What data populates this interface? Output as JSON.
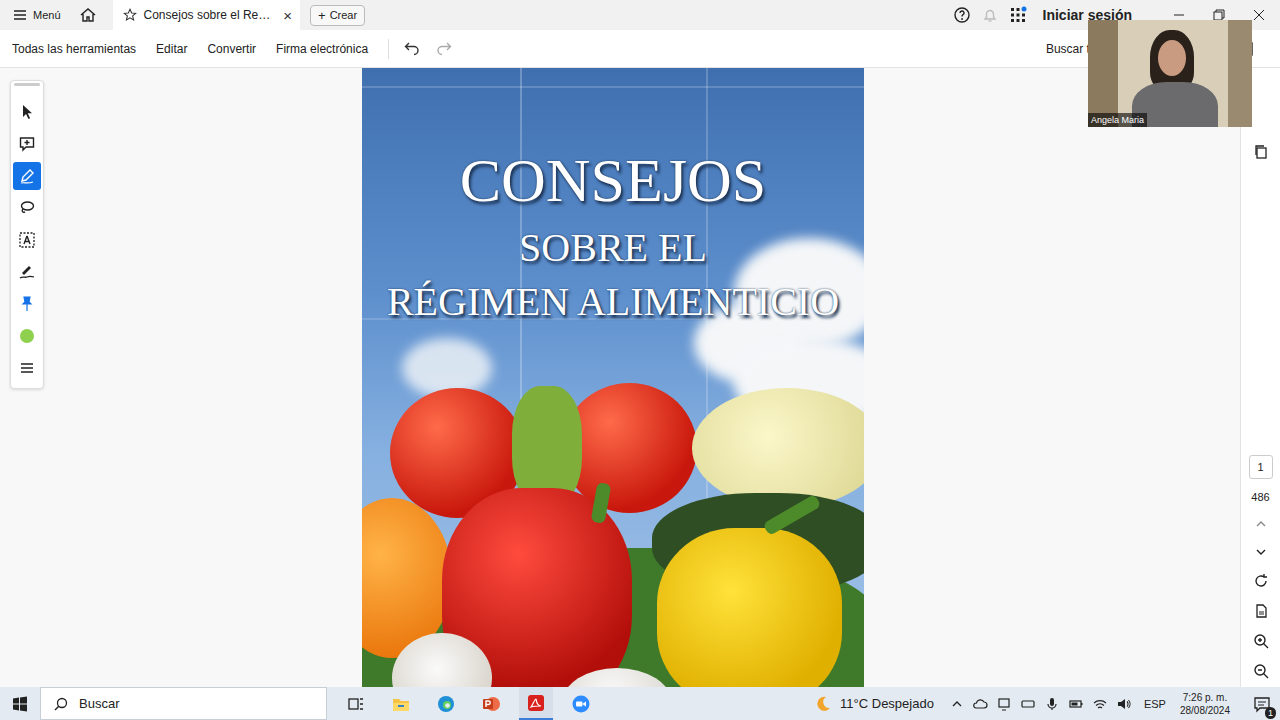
{
  "app_bar": {
    "menu": "Menú",
    "tab": {
      "label": "Consejos sobre el Re…",
      "selected": true,
      "close": "×"
    },
    "create_icon": "+",
    "create": "Crear",
    "sign_in": "Iniciar sesión"
  },
  "toolbar": {
    "items": [
      "Todas las herramientas",
      "Editar",
      "Convertir",
      "Firma electrónica"
    ],
    "search": "Buscar texto o herramientas"
  },
  "tools": [
    {
      "kind": "select",
      "selected": false
    },
    {
      "kind": "comment",
      "selected": false
    },
    {
      "kind": "pen",
      "selected": true
    },
    {
      "kind": "lasso",
      "selected": false
    },
    {
      "kind": "text-box",
      "selected": false
    },
    {
      "kind": "sign",
      "selected": false
    },
    {
      "kind": "pin",
      "selected": false
    },
    {
      "kind": "color",
      "selected": false,
      "color": "#8fd14f"
    },
    {
      "kind": "menu",
      "selected": false
    }
  ],
  "document": {
    "title_lines": [
      "CONSEJOS",
      "SOBRE EL",
      "RÉGIMEN ALIMENTICIO"
    ]
  },
  "page_nav": {
    "current": "1",
    "total": "486"
  },
  "video": {
    "name": "Angela Maria"
  },
  "taskbar": {
    "search": "Buscar",
    "apps": [
      {
        "kind": "task-view",
        "active": false
      },
      {
        "kind": "explorer",
        "active": false
      },
      {
        "kind": "edge",
        "active": false
      },
      {
        "kind": "powerpoint",
        "active": false
      },
      {
        "kind": "acrobat",
        "active": true
      },
      {
        "kind": "zoom",
        "active": false
      }
    ],
    "weather": "11°C Despejado",
    "language": "ESP",
    "time": "7:26 p. m.",
    "date": "28/08/2024",
    "notifications": "1"
  }
}
